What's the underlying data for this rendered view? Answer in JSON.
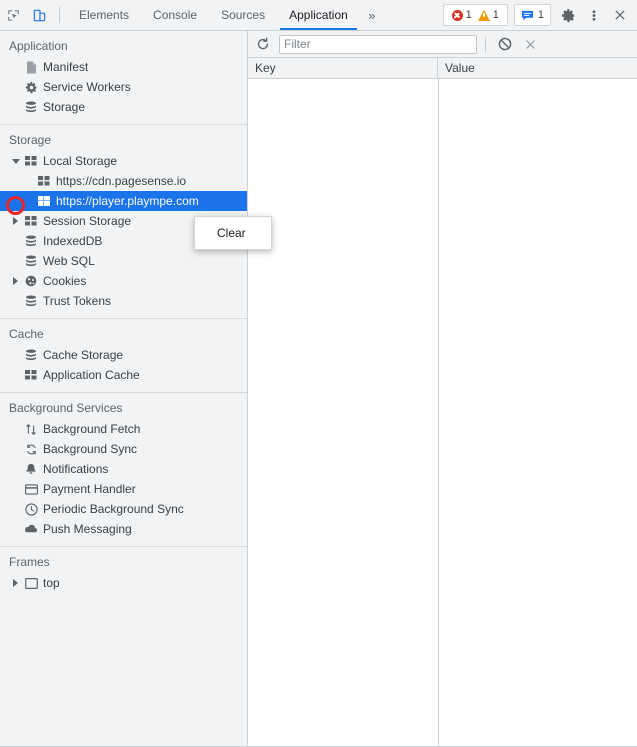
{
  "toolbar": {
    "inspect_icon": "inspect-cursor-icon",
    "device_icon": "device-toolbar-icon",
    "tabs": [
      {
        "label": "Elements",
        "active": false
      },
      {
        "label": "Console",
        "active": false
      },
      {
        "label": "Sources",
        "active": false
      },
      {
        "label": "Application",
        "active": true
      }
    ],
    "more_tabs_label": "»",
    "errors_count": "1",
    "warnings_count": "1",
    "issues_count": "1",
    "settings_icon": "gear-icon",
    "more_icon": "kebab-menu-icon",
    "close_icon": "close-icon",
    "accent_color": "#1a73e8",
    "error_color": "#d93025",
    "warning_color": "#f29900"
  },
  "sidebar": {
    "sections": [
      {
        "title": "Application",
        "items": [
          {
            "label": "Manifest",
            "icon": "manifest-document-icon",
            "indent": 1,
            "twisty": "none",
            "selected": false
          },
          {
            "label": "Service Workers",
            "icon": "gear-icon",
            "indent": 1,
            "twisty": "none",
            "selected": false
          },
          {
            "label": "Storage",
            "icon": "database-icon",
            "indent": 1,
            "twisty": "none",
            "selected": false
          }
        ]
      },
      {
        "title": "Storage",
        "items": [
          {
            "label": "Local Storage",
            "icon": "table-grid-icon",
            "indent": 0,
            "twisty": "open",
            "selected": false
          },
          {
            "label": "https://cdn.pagesense.io",
            "icon": "table-grid-icon",
            "indent": 2,
            "twisty": "none",
            "selected": false
          },
          {
            "label": "https://player.plaympe.com",
            "icon": "table-grid-icon",
            "indent": 2,
            "twisty": "none",
            "selected": true
          },
          {
            "label": "Session Storage",
            "icon": "table-grid-icon",
            "indent": 0,
            "twisty": "closed",
            "selected": false
          },
          {
            "label": "IndexedDB",
            "icon": "database-icon",
            "indent": 1,
            "twisty": "none",
            "selected": false
          },
          {
            "label": "Web SQL",
            "icon": "database-icon",
            "indent": 1,
            "twisty": "none",
            "selected": false
          },
          {
            "label": "Cookies",
            "icon": "cookie-icon",
            "indent": 0,
            "twisty": "closed",
            "selected": false
          },
          {
            "label": "Trust Tokens",
            "icon": "database-icon",
            "indent": 1,
            "twisty": "none",
            "selected": false
          }
        ]
      },
      {
        "title": "Cache",
        "items": [
          {
            "label": "Cache Storage",
            "icon": "database-icon",
            "indent": 1,
            "twisty": "none",
            "selected": false
          },
          {
            "label": "Application Cache",
            "icon": "table-grid-icon",
            "indent": 1,
            "twisty": "none",
            "selected": false
          }
        ]
      },
      {
        "title": "Background Services",
        "items": [
          {
            "label": "Background Fetch",
            "icon": "arrows-up-down-icon",
            "indent": 1,
            "twisty": "none",
            "selected": false
          },
          {
            "label": "Background Sync",
            "icon": "sync-arrows-icon",
            "indent": 1,
            "twisty": "none",
            "selected": false
          },
          {
            "label": "Notifications",
            "icon": "bell-icon",
            "indent": 1,
            "twisty": "none",
            "selected": false
          },
          {
            "label": "Payment Handler",
            "icon": "credit-card-icon",
            "indent": 1,
            "twisty": "none",
            "selected": false
          },
          {
            "label": "Periodic Background Sync",
            "icon": "clock-icon",
            "indent": 1,
            "twisty": "none",
            "selected": false
          },
          {
            "label": "Push Messaging",
            "icon": "cloud-icon",
            "indent": 1,
            "twisty": "none",
            "selected": false
          }
        ]
      },
      {
        "title": "Frames",
        "items": [
          {
            "label": "top",
            "icon": "frame-icon",
            "indent": 0,
            "twisty": "closed",
            "selected": false
          }
        ]
      }
    ],
    "annotation": {
      "type": "red-ring-highlight",
      "color": "#e8242a",
      "target": "local-storage-twisty"
    }
  },
  "context_menu": {
    "items": [
      {
        "label": "Clear"
      }
    ]
  },
  "main": {
    "filter_bar": {
      "refresh_icon": "refresh-icon",
      "filter_placeholder": "Filter",
      "filter_value": "",
      "clear_all_icon": "clear-all-icon",
      "delete_icon": "delete-x-icon"
    },
    "grid": {
      "columns": [
        "Key",
        "Value"
      ],
      "rows": []
    }
  }
}
